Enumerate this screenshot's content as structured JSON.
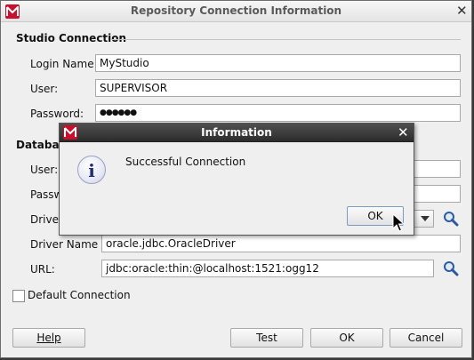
{
  "window": {
    "title": "Repository Connection Information",
    "close_glyph": "✕"
  },
  "studio": {
    "section_title": "Studio Connection",
    "login_label": "Login Name:",
    "login_value": "MyStudio",
    "user_label": "User:",
    "user_value": "SUPERVISOR",
    "password_label": "Password:",
    "password_value": "●●●●●●"
  },
  "database": {
    "section_title": "Databas",
    "user_label": "User:",
    "password_label": "Passw",
    "driver_label": "Driver",
    "driver_name_label": "Driver Name :",
    "driver_name_value": "oracle.jdbc.OracleDriver",
    "url_label": "URL:",
    "url_value": "jdbc:oracle:thin:@localhost:1521:ogg12"
  },
  "default_connection_label": "Default Connection",
  "buttons": {
    "help": "Help",
    "test": "Test",
    "ok": "OK",
    "cancel": "Cancel"
  },
  "info_dialog": {
    "title": "Information",
    "message": "Successful Connection",
    "ok": "OK",
    "icon_glyph": "i",
    "close_glyph": "✕"
  }
}
